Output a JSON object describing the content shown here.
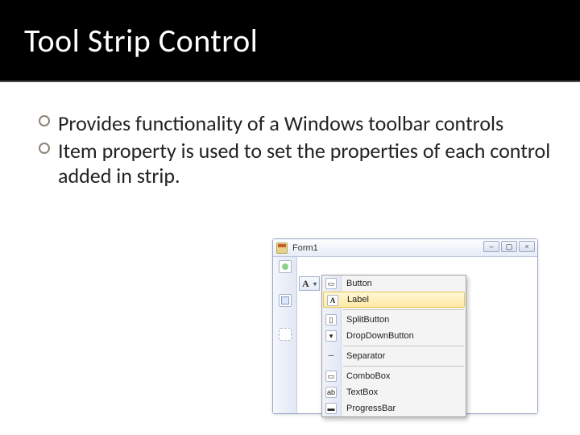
{
  "title": "Tool Strip Control",
  "bullets": [
    "Provides functionality of a Windows toolbar controls",
    "Item property is used to set the properties of each control added in strip."
  ],
  "figure": {
    "window_title": "Form1",
    "menu_trigger_letter": "A",
    "dropdown_items": [
      {
        "label": "Button",
        "highlight": false
      },
      {
        "label": "Label",
        "highlight": true
      },
      {
        "label": "SplitButton",
        "highlight": false
      },
      {
        "label": "DropDownButton",
        "highlight": false
      },
      {
        "label": "Separator",
        "highlight": false
      },
      {
        "label": "ComboBox",
        "highlight": false
      },
      {
        "label": "TextBox",
        "highlight": false
      },
      {
        "label": "ProgressBar",
        "highlight": false
      }
    ]
  }
}
